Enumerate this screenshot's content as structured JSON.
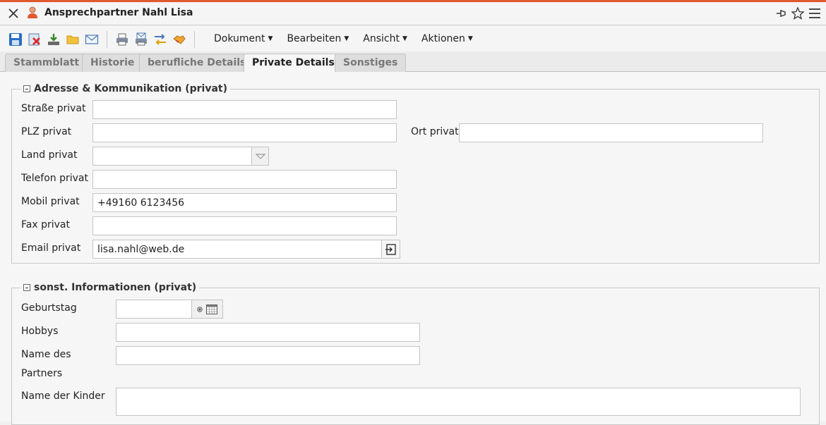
{
  "window": {
    "title": "Ansprechpartner Nahl Lisa",
    "accent_color": "#e0592f"
  },
  "toolbar": {
    "icons": [
      "save-icon",
      "delete-icon",
      "download-icon",
      "folder-icon",
      "mail-icon",
      "print-icon",
      "print-mail-icon",
      "transfer-icon",
      "handshake-icon"
    ],
    "menus": [
      {
        "label": "Dokument"
      },
      {
        "label": "Bearbeiten"
      },
      {
        "label": "Ansicht"
      },
      {
        "label": "Aktionen"
      }
    ]
  },
  "tabs": [
    {
      "label": "Stammblatt",
      "active": false
    },
    {
      "label": "Historie",
      "active": false
    },
    {
      "label": "berufliche Details",
      "active": false
    },
    {
      "label": "Private Details",
      "active": true
    },
    {
      "label": "Sonstiges",
      "active": false
    }
  ],
  "address_section": {
    "title": "Adresse & Kommunikation (privat)",
    "fields": {
      "street": {
        "label": "Straße privat",
        "value": ""
      },
      "zip": {
        "label": "PLZ privat",
        "value": ""
      },
      "city": {
        "label": "Ort privat",
        "value": ""
      },
      "country": {
        "label": "Land privat",
        "value": ""
      },
      "phone": {
        "label": "Telefon privat",
        "value": ""
      },
      "mobile": {
        "label": "Mobil privat",
        "value": "+49160 6123456"
      },
      "fax": {
        "label": "Fax privat",
        "value": ""
      },
      "email": {
        "label": "Email privat",
        "value": "lisa.nahl@web.de"
      }
    }
  },
  "other_section": {
    "title": "sonst. Informationen (privat)",
    "fields": {
      "birthday": {
        "label": "Geburtstag",
        "value": ""
      },
      "hobbies": {
        "label": "Hobbys",
        "value": ""
      },
      "partner_name": {
        "label_line1": "Name des",
        "label_line2": "Partners",
        "value": ""
      },
      "children_names": {
        "label": "Name der Kinder",
        "value": ""
      }
    }
  }
}
